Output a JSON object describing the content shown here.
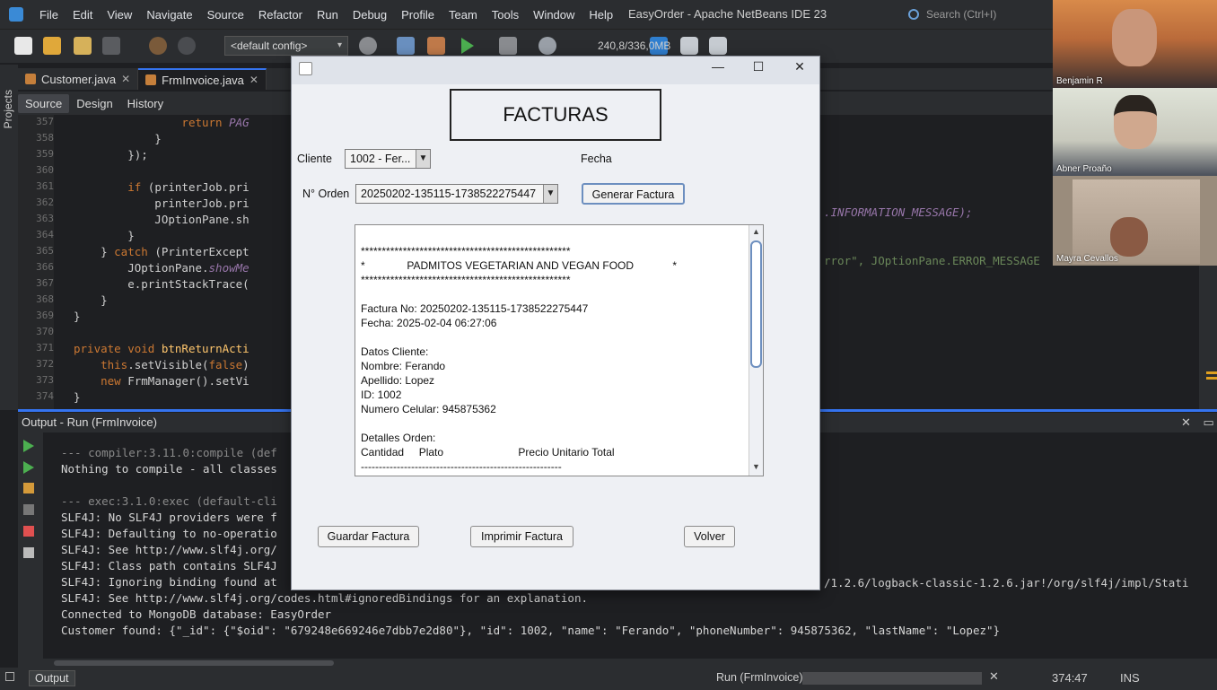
{
  "menubar": {
    "items": [
      "File",
      "Edit",
      "View",
      "Navigate",
      "Source",
      "Refactor",
      "Run",
      "Debug",
      "Profile",
      "Team",
      "Tools",
      "Window",
      "Help"
    ],
    "title": "EasyOrder - Apache NetBeans IDE 23",
    "search_placeholder": "Search (Ctrl+I)"
  },
  "toolbar": {
    "config": "<default config>",
    "memory": "240,8/336,0MB"
  },
  "sidebar": {
    "projects_label": "Projects"
  },
  "tabs": [
    {
      "label": "Customer.java",
      "active": false
    },
    {
      "label": "FrmInvoice.java",
      "active": true
    }
  ],
  "editor_toolbar": {
    "source": "Source",
    "design": "Design",
    "history": "History"
  },
  "editor": {
    "lines": [
      {
        "n": "357",
        "text": "                return PAG"
      },
      {
        "n": "358",
        "text": "            }"
      },
      {
        "n": "359",
        "text": "        });"
      },
      {
        "n": "360",
        "text": ""
      },
      {
        "n": "361",
        "text": "        if (printerJob.pri"
      },
      {
        "n": "362",
        "text": "            printerJob.pri"
      },
      {
        "n": "363",
        "text": "            JOptionPane.sh"
      },
      {
        "n": "364",
        "text": "        }"
      },
      {
        "n": "365",
        "text": "    } catch (PrinterExcept"
      },
      {
        "n": "366",
        "text": "        JOptionPane.showMe"
      },
      {
        "n": "367",
        "text": "        e.printStackTrace("
      },
      {
        "n": "368",
        "text": "    }"
      },
      {
        "n": "369",
        "text": "}"
      },
      {
        "n": "370",
        "text": ""
      },
      {
        "n": "371",
        "text": "private void btnReturnActi"
      },
      {
        "n": "372",
        "text": "    this.setVisible(false)"
      },
      {
        "n": "373",
        "text": "    new FrmManager().setVi"
      },
      {
        "n": "374",
        "text": "}"
      }
    ],
    "right_frag_1": ".INFORMATION_MESSAGE);",
    "right_frag_2": "rror\", JOptionPane.ERROR_MESSAGE"
  },
  "output": {
    "header": "Output - Run (FrmInvoice)",
    "lines": [
      {
        "text": "--- compiler:3.11.0:compile (def",
        "dim": true
      },
      {
        "text": "Nothing to compile - all classes",
        "dim": false
      },
      {
        "text": "",
        "dim": false
      },
      {
        "text": "--- exec:3.1.0:exec (default-cli",
        "dim": true
      },
      {
        "text": "SLF4J: No SLF4J providers were f",
        "dim": false
      },
      {
        "text": "SLF4J: Defaulting to no-operatio",
        "dim": false
      },
      {
        "text": "SLF4J: See http://www.slf4j.org/",
        "dim": false
      },
      {
        "text": "SLF4J: Class path contains SLF4J",
        "dim": false
      },
      {
        "text": "SLF4J: Ignoring binding found at",
        "dim": false
      },
      {
        "text": "SLF4J: See http://www.slf4j.org/codes.html#ignoredBindings for an explanation.",
        "dim": false
      },
      {
        "text": "Connected to MongoDB database: EasyOrder",
        "dim": false
      },
      {
        "text": "Customer found: {\"_id\": {\"$oid\": \"679248e669246e7dbb7e2d80\"}, \"id\": 1002, \"name\": \"Ferando\", \"phoneNumber\": 945875362, \"lastName\": \"Lopez\"}",
        "dim": false
      }
    ],
    "right_frag": "/1.2.6/logback-classic-1.2.6.jar!/org/slf4j/impl/Stati"
  },
  "statusbar": {
    "output_tab": "Output",
    "run_label": "Run (FrmInvoice)",
    "position": "374:47",
    "mode": "INS"
  },
  "webcams": [
    {
      "name": "Benjamin R"
    },
    {
      "name": "Abner Proaño"
    },
    {
      "name": "Mayra Cevallos"
    }
  ],
  "dialog": {
    "heading": "FACTURAS",
    "cliente_label": "Cliente",
    "cliente_value": "1002 - Fer...",
    "fecha_label": "Fecha",
    "orden_label": "N° Orden",
    "orden_value": "20250202-135115-1738522275447",
    "generar_button": "Generar Factura",
    "guardar_button": "Guardar Factura",
    "imprimir_button": "Imprimir Factura",
    "volver_button": "Volver",
    "invoice_lines": [
      "",
      "**************************************************",
      "*              PADMITOS VEGETARIAN AND VEGAN FOOD             *",
      "**************************************************",
      "",
      "Factura No: 20250202-135115-1738522275447",
      "Fecha: 2025-02-04 06:27:06",
      "",
      "Datos Cliente:",
      "Nombre: Ferando",
      "Apellido: Lopez",
      "ID: 1002",
      "Numero Celular: 945875362",
      "",
      "Detalles Orden:",
      "Cantidad     Plato                         Precio Unitario Total",
      "--------------------------------------------------------"
    ]
  }
}
